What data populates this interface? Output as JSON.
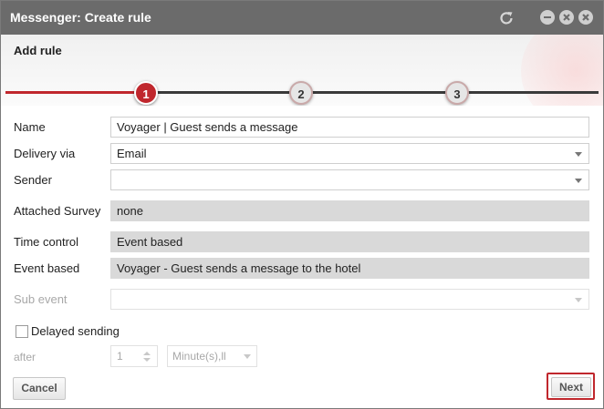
{
  "window": {
    "title": "Messenger: Create rule"
  },
  "header": {
    "subtitle": "Add rule"
  },
  "steps": [
    {
      "label": "1",
      "state": "active"
    },
    {
      "label": "2",
      "state": "inactive"
    },
    {
      "label": "3",
      "state": "inactive"
    }
  ],
  "form": {
    "name": {
      "label": "Name",
      "value": "Voyager | Guest sends a message"
    },
    "delivery_via": {
      "label": "Delivery via",
      "value": "Email"
    },
    "sender": {
      "label": "Sender",
      "value": ""
    },
    "attached_survey": {
      "label": "Attached Survey",
      "value": "none"
    },
    "time_control": {
      "label": "Time control",
      "value": "Event based"
    },
    "event_based": {
      "label": "Event based",
      "value": "Voyager - Guest sends a message to the hotel"
    },
    "sub_event": {
      "label": "Sub event",
      "value": ""
    },
    "delayed_sending": {
      "label": "Delayed sending",
      "checked": false
    },
    "after": {
      "label": "after",
      "value": "1",
      "unit": "Minute(s),ll"
    }
  },
  "buttons": {
    "cancel": "Cancel",
    "next": "Next"
  },
  "colors": {
    "titlebar": "#6b6b6b",
    "accent": "#c0272d",
    "readonly_field": "#d9d9d9"
  }
}
